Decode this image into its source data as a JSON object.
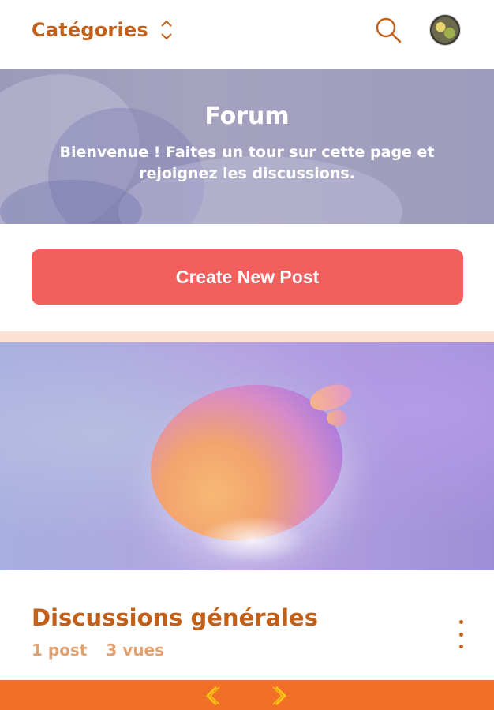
{
  "header": {
    "categories_label": "Catégories",
    "icons": [
      "chevron-up-down-icon",
      "search-icon",
      "avatar"
    ]
  },
  "banner": {
    "title": "Forum",
    "subtitle": "Bienvenue ! Faites un tour sur cette page et rejoignez les discussions."
  },
  "create_button": {
    "label": "Create New Post"
  },
  "category": {
    "title": "Discussions générales",
    "posts": "1 post",
    "views": "3 vues"
  },
  "colors": {
    "accent": "#c2601a",
    "cta": "#f25f5c",
    "bottom_bar": "#f26f27",
    "meta": "#e0a170"
  }
}
